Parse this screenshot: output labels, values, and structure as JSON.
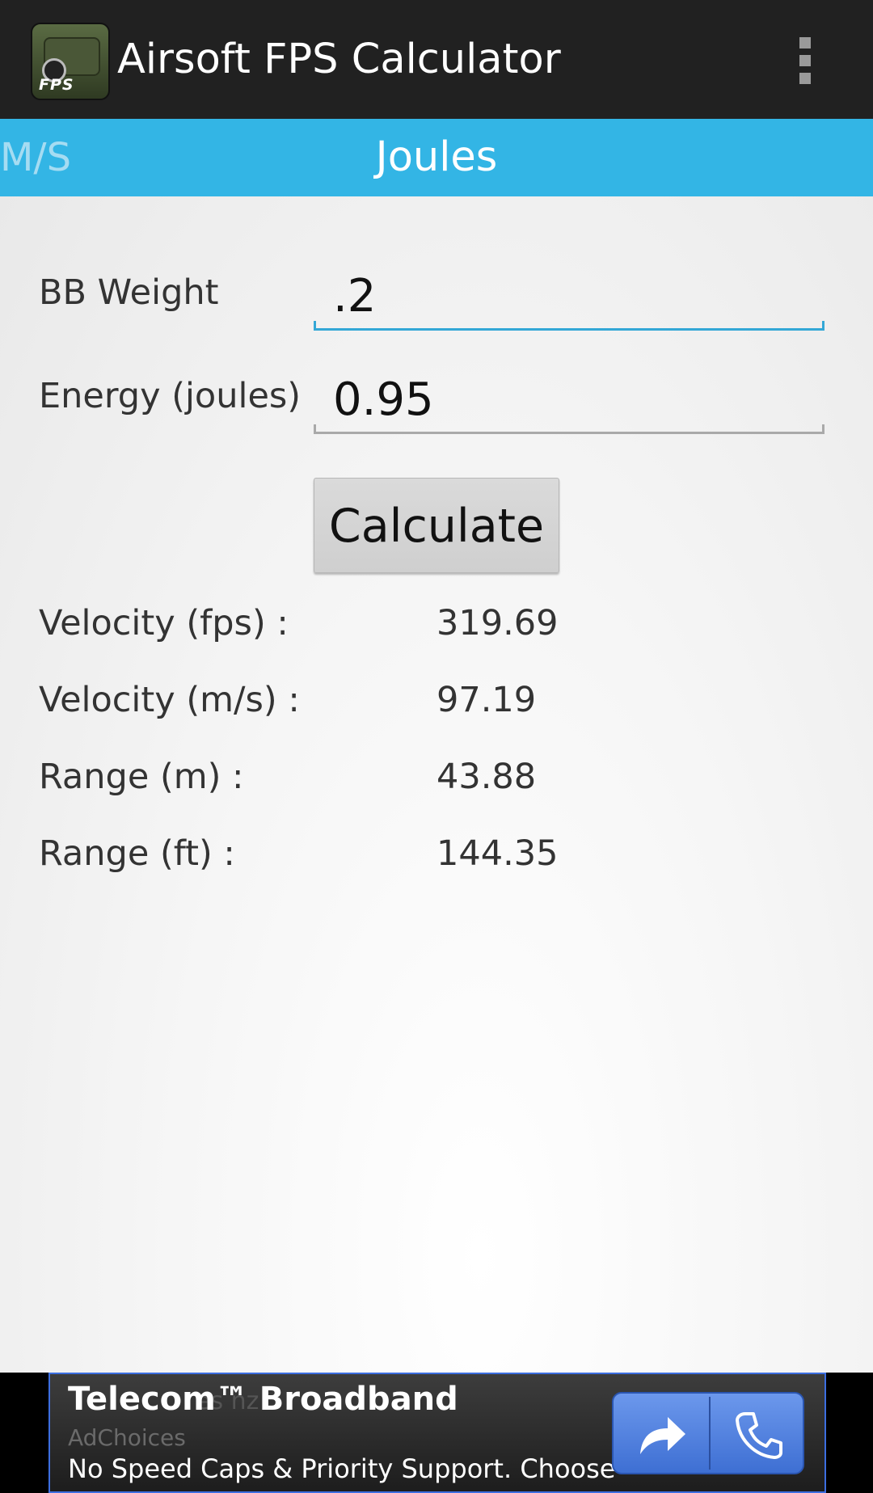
{
  "app": {
    "title": "Airsoft FPS Calculator",
    "icon_text": "FPS"
  },
  "tabs": {
    "previous": "M/S",
    "current": "Joules"
  },
  "form": {
    "bb_weight_label": "BB Weight",
    "bb_weight_value": ".2",
    "energy_label": "Energy (joules)",
    "energy_value": "0.95",
    "calculate_label": "Calculate"
  },
  "results": [
    {
      "label": "Velocity (fps) :",
      "value": "319.69"
    },
    {
      "label": "Velocity (m/s) :",
      "value": "97.19"
    },
    {
      "label": "Range (m) :",
      "value": "43.88"
    },
    {
      "label": "Range (ft) :",
      "value": "144.35"
    }
  ],
  "ad": {
    "title": "Telecom™ Broadband",
    "ghost_text": "es              nz",
    "adchoices": "AdChoices",
    "text": "No Speed Caps & Priority Support. Choose"
  },
  "colors": {
    "accent": "#33b5e5",
    "action_bar": "#212121",
    "ad_button": "#4f7fe0"
  }
}
